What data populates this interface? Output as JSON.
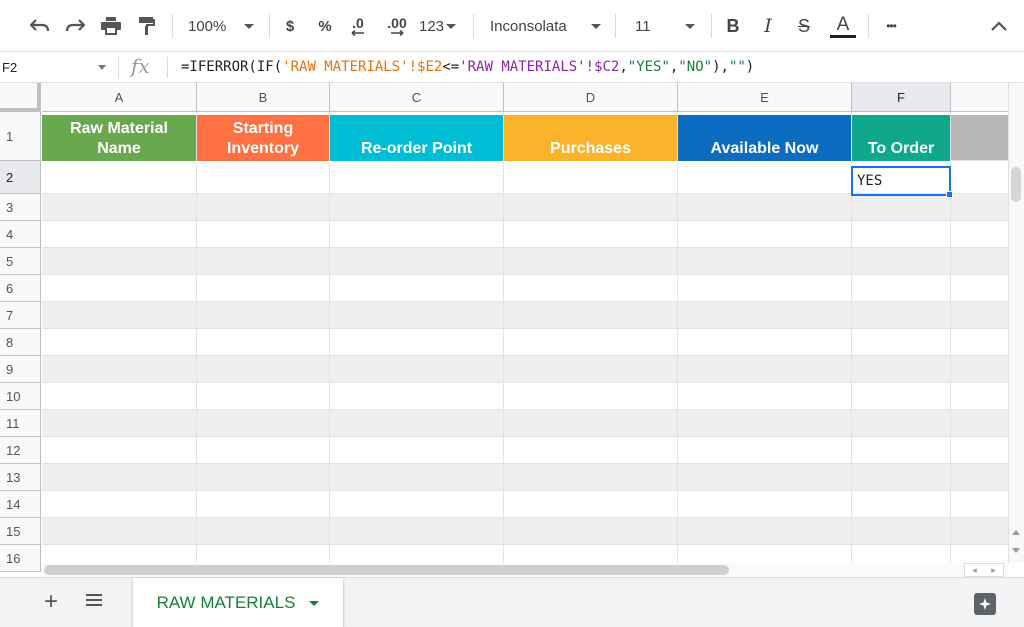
{
  "toolbar": {
    "zoom": "100%",
    "currency": "$",
    "percent": "%",
    "decrease_decimal": ".0",
    "increase_decimal": ".00",
    "number_format": "123",
    "font": "Inconsolata",
    "font_size": "11",
    "bold": "B",
    "italic": "I",
    "strikethrough": "S",
    "text_color": "A",
    "more": "•••"
  },
  "formula_bar": {
    "name_box": "F2",
    "fx": "fx",
    "formula_parts": [
      "=IFERROR(IF(",
      "'RAW MATERIALS'!$E2",
      "<=",
      "'RAW MATERIALS'!$C2",
      ",",
      "\"YES\"",
      ",",
      "\"NO\"",
      "),",
      "\"\"",
      ")"
    ]
  },
  "columns": [
    "A",
    "B",
    "C",
    "D",
    "E",
    "F"
  ],
  "rows": [
    "1",
    "2",
    "3",
    "4",
    "5",
    "6",
    "7",
    "8",
    "9",
    "10",
    "11",
    "12",
    "13",
    "14",
    "15",
    "16"
  ],
  "headers": [
    {
      "line1": "Raw Material",
      "line2": "Name",
      "color": "#6aa84f"
    },
    {
      "line1": "Starting",
      "line2": "Inventory",
      "color": "#ff7043"
    },
    {
      "line1": "",
      "line2": "Re-order Point",
      "color": "#00bcd4"
    },
    {
      "line1": "",
      "line2": "Purchases",
      "color": "#fbb32b"
    },
    {
      "line1": "",
      "line2": "Available Now",
      "color": "#0b6cc0"
    },
    {
      "line1": "",
      "line2": "To Order",
      "color": "#0fa88a"
    }
  ],
  "cells": {
    "F2": "YES"
  },
  "sheet_tab": {
    "name": "RAW MATERIALS"
  },
  "colors": {
    "accent": "#1a73e8",
    "tab_text": "#188038",
    "band": "#efefef"
  }
}
